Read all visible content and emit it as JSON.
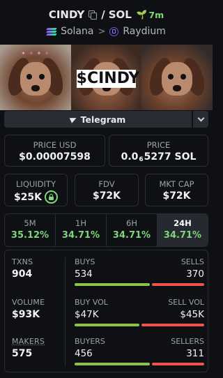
{
  "header": {
    "symbol": "CINDY",
    "quote": "SOL",
    "separator": "/",
    "age": "7m",
    "chain": "Solana",
    "dex": "Raydium"
  },
  "banner": {
    "text": "$CINDY"
  },
  "social": {
    "telegram_label": "Telegram"
  },
  "prices": {
    "usd_label": "PRICE USD",
    "usd_value": "$0.00007598",
    "native_label": "PRICE",
    "native_prefix": "0.0",
    "native_zeros": "6",
    "native_suffix": "5277 SOL"
  },
  "metrics": {
    "liquidity_label": "LIQUIDITY",
    "liquidity_value": "$25K",
    "fdv_label": "FDV",
    "fdv_value": "$72K",
    "mcap_label": "MKT CAP",
    "mcap_value": "$72K"
  },
  "timeframes": [
    {
      "label": "5M",
      "value": "35.12%"
    },
    {
      "label": "1H",
      "value": "34.71%"
    },
    {
      "label": "6H",
      "value": "34.71%"
    },
    {
      "label": "24H",
      "value": "34.71%",
      "selected": true
    }
  ],
  "stats": {
    "txns_label": "TXNS",
    "txns_value": "904",
    "buys_label": "BUYS",
    "buys_value": "534",
    "sells_label": "SELLS",
    "sells_value": "370",
    "buys_ratio": 0.59,
    "volume_label": "VOLUME",
    "volume_value": "$93K",
    "buyvol_label": "BUY VOL",
    "buyvol_value": "$47K",
    "sellvol_label": "SELL VOL",
    "sellvol_value": "$45K",
    "buyvol_ratio": 0.51,
    "makers_label": "MAKERS",
    "makers_value": "575",
    "buyers_label": "BUYERS",
    "buyers_value": "456",
    "sellers_label": "SELLERS",
    "sellers_value": "311",
    "buyers_ratio": 0.59
  },
  "colors": {
    "positive": "#7fd67a",
    "buy_bar": "#8bc34a",
    "sell_bar": "#ef5350",
    "background": "#0f1014"
  }
}
